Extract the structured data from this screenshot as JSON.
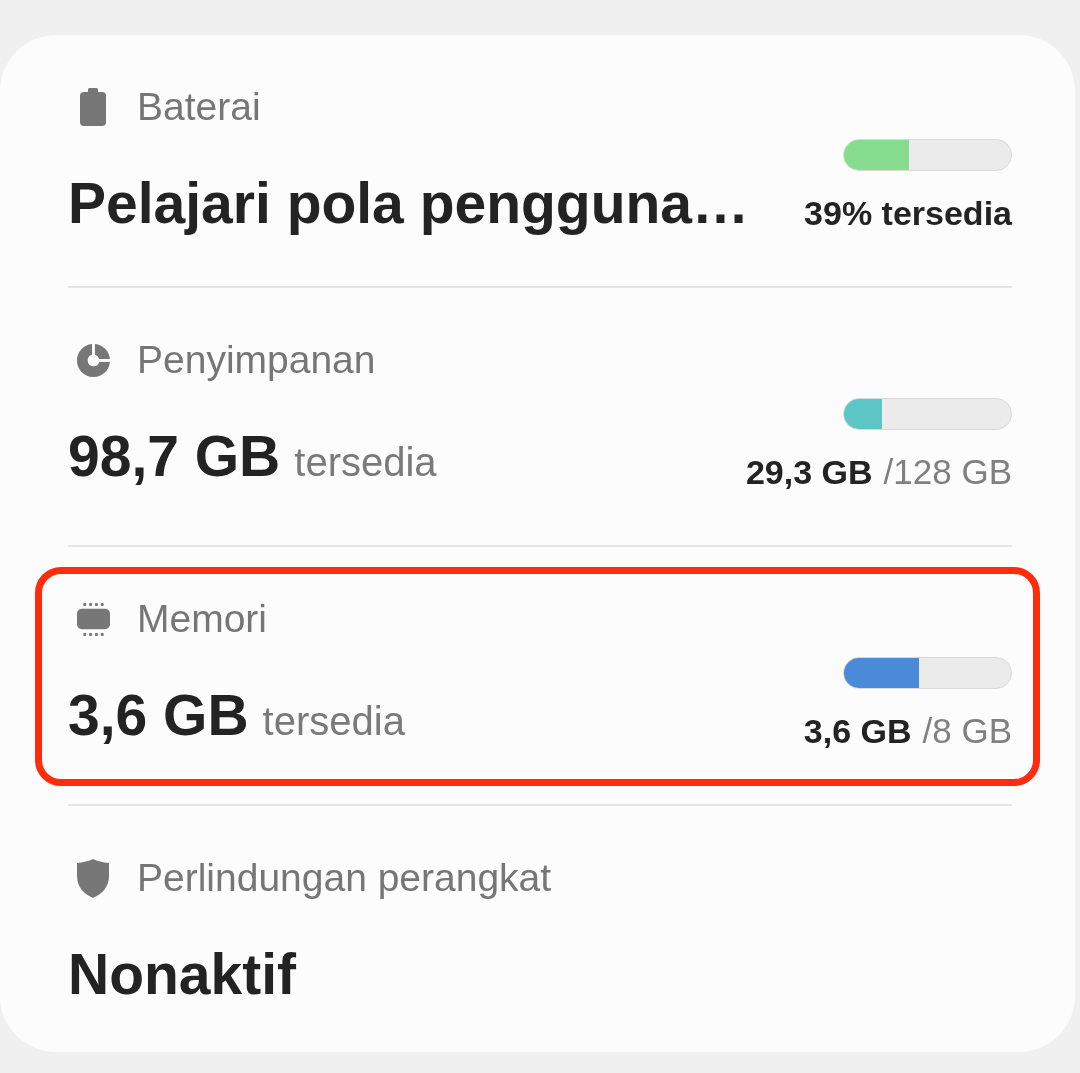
{
  "sections": [
    {
      "label": "Baterai",
      "value": "Pelajari pola pengguna…",
      "meter": {
        "level": 0.39,
        "color": "#86dc8f"
      },
      "reading": {
        "value": "39% tersedia"
      },
      "highlighted": false
    },
    {
      "label": "Penyimpanan",
      "value": "98,7 GB",
      "unit": "tersedia",
      "meter": {
        "level": 0.23,
        "color": "#5cc6c6"
      },
      "reading": {
        "value": "29,3 GB",
        "total": "/128 GB"
      },
      "highlighted": false
    },
    {
      "label": "Memori",
      "value": "3,6 GB",
      "unit": "tersedia",
      "meter": {
        "level": 0.45,
        "color": "#4a8ad6"
      },
      "reading": {
        "value": "3,6 GB",
        "total": "/8 GB"
      },
      "highlighted": true
    },
    {
      "label": "Perlindungan perangkat",
      "value": "Nonaktif",
      "highlighted": false
    }
  ]
}
